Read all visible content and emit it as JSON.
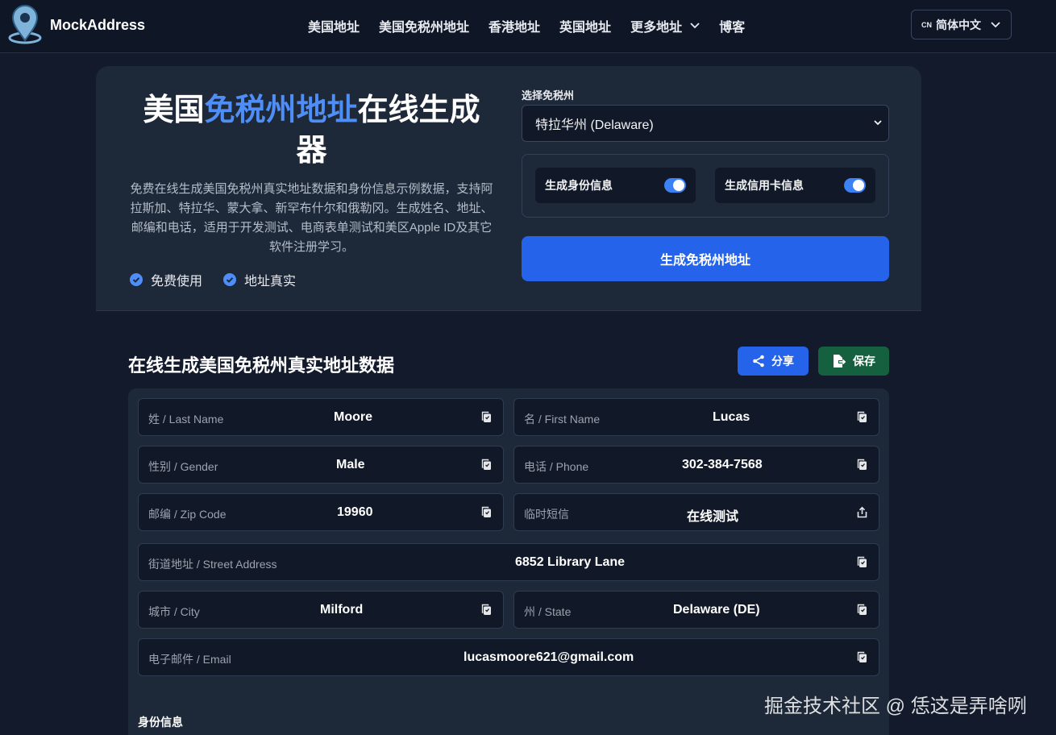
{
  "brand": {
    "name": "MockAddress"
  },
  "nav": {
    "items": [
      "美国地址",
      "美国免税州地址",
      "香港地址",
      "英国地址",
      "更多地址",
      "博客"
    ],
    "language_code": "CN",
    "language_label": "简体中文"
  },
  "hero": {
    "title_prefix": "美国",
    "title_highlight": "免税州地址",
    "title_suffix": "在线生成器",
    "description": "免费在线生成美国免税州真实地址数据和身份信息示例数据，支持阿拉斯加、特拉华、蒙大拿、新罕布什尔和俄勒冈。生成姓名、地址、邮编和电话，适用于开发测试、电商表单测试和美区Apple ID及其它软件注册学习。",
    "features": [
      "免费使用",
      "地址真实"
    ]
  },
  "form": {
    "state_label": "选择免税州",
    "state_selected": "特拉华州 (Delaware)",
    "toggle_identity": "生成身份信息",
    "toggle_card": "生成信用卡信息",
    "toggle_identity_on": true,
    "toggle_card_on": true,
    "generate_button": "生成免税州地址"
  },
  "results": {
    "title": "在线生成美国免税州真实地址数据",
    "share_button": "分享",
    "save_button": "保存",
    "fields": {
      "last_name": {
        "label": "姓 / Last Name",
        "value": "Moore"
      },
      "first_name": {
        "label": "名 / First Name",
        "value": "Lucas"
      },
      "gender": {
        "label": "性别 / Gender",
        "value": "Male"
      },
      "phone": {
        "label": "电话 / Phone",
        "value": "302-384-7568"
      },
      "zip": {
        "label": "邮编 / Zip Code",
        "value": "19960"
      },
      "sms": {
        "label": "临时短信",
        "value": "在线测试"
      },
      "street": {
        "label": "街道地址 / Street Address",
        "value": "6852 Library Lane"
      },
      "city": {
        "label": "城市 / City",
        "value": "Milford"
      },
      "state": {
        "label": "州 / State",
        "value": "Delaware (DE)"
      },
      "email": {
        "label": "电子邮件 / Email",
        "value": "lucasmoore621@gmail.com"
      }
    },
    "identity_section_label": "身份信息"
  },
  "watermark": "掘金技术社区 @ 恁这是弄啥咧",
  "colors": {
    "accent": "#2563eb",
    "highlight": "#4f8ef7",
    "save": "#15603f",
    "background": "#121a2b"
  }
}
